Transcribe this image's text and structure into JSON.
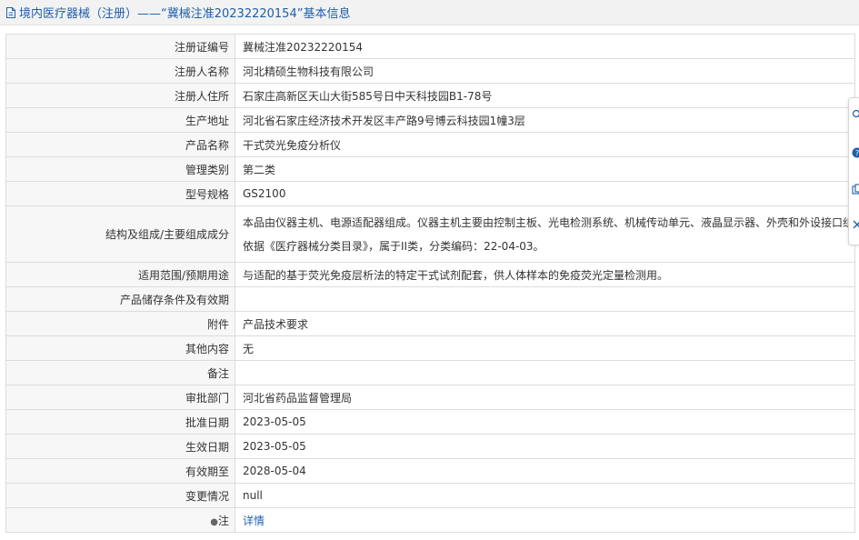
{
  "header": {
    "title": "境内医疗器械（注册）——“冀械注准20232220154”基本信息"
  },
  "rows": [
    {
      "label": "注册证编号",
      "value": "冀械注准20232220154"
    },
    {
      "label": "注册人名称",
      "value": "河北精硕生物科技有限公司"
    },
    {
      "label": "注册人住所",
      "value": "石家庄高新区天山大街585号日中天科技园B1-78号"
    },
    {
      "label": "生产地址",
      "value": "河北省石家庄经济技术开发区丰产路9号博云科技园1幢3层"
    },
    {
      "label": "产品名称",
      "value": "干式荧光免疫分析仪"
    },
    {
      "label": "管理类别",
      "value": "第二类"
    },
    {
      "label": "型号规格",
      "value": "GS2100"
    },
    {
      "label": "结构及组成/主要组成成分",
      "value_lines": [
        "本品由仪器主机、电源适配器组成。仪器主机主要由控制主板、光电检测系统、机械传动单元、液晶显示器、外壳和外设接口组成。",
        "依据《医疗器械分类目录》，属于II类，分类编码：22-04-03。"
      ]
    },
    {
      "label": "适用范围/预期用途",
      "value": "与适配的基于荧光免疫层析法的特定干式试剂配套，供人体样本的免疫荧光定量检测用。"
    },
    {
      "label": "产品储存条件及有效期",
      "value": ""
    },
    {
      "label": "附件",
      "value": "产品技术要求"
    },
    {
      "label": "其他内容",
      "value": "无"
    },
    {
      "label": "备注",
      "value": ""
    },
    {
      "label": "审批部门",
      "value": "河北省药品监督管理局"
    },
    {
      "label": "批准日期",
      "value": "2023-05-05"
    },
    {
      "label": "生效日期",
      "value": "2023-05-05"
    },
    {
      "label": "有效期至",
      "value": "2028-05-04"
    },
    {
      "label": "变更情况",
      "value": "null"
    },
    {
      "label": "注",
      "value": "详情"
    }
  ],
  "icons": {
    "header": "document-icon",
    "note_row": "pin-icon",
    "side_widget": [
      "search-icon",
      "help-icon",
      "copy-icon",
      "close-icon"
    ]
  },
  "colors": {
    "title": "#1f5ea8",
    "link": "#1f63b3",
    "label_bg": "#f7f7f7",
    "header_bg": "#f2f2f2",
    "border": "#dcdcdc"
  }
}
